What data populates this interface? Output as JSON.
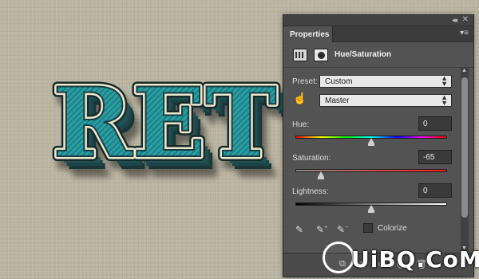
{
  "artwork": {
    "text": "RET"
  },
  "panel": {
    "title": "Properties",
    "adjustment_title": "Hue/Saturation",
    "collapse_glyph": "◂◂",
    "close_glyph": "✕",
    "menu_glyph": "▾≡",
    "preset_label": "Preset:",
    "preset_value": "Custom",
    "channel_value": "Master",
    "hue_label": "Hue:",
    "hue_value": "0",
    "saturation_label": "Saturation:",
    "saturation_value": "-65",
    "lightness_label": "Lightness:",
    "lightness_value": "0",
    "colorize_label": "Colorize",
    "colorize_checked": false,
    "hue_slider_fraction": 0.5,
    "saturation_slider_fraction": 0.175,
    "lightness_slider_fraction": 0.5
  },
  "icons": {
    "adjustment": "hue-saturation-icon",
    "mask": "mask-icon",
    "hand": "targeted-adjustment-hand-icon",
    "eyedropper": "eyedropper-icon",
    "eyedropper_add": "eyedropper-plus-icon",
    "eyedropper_sub": "eyedropper-minus-icon"
  },
  "watermark": {
    "text": "UiBQ.CoM"
  },
  "colors": {
    "panel_bg": "#535353",
    "teal": "#2aa3a8",
    "cream": "#eee7cf",
    "background": "#b9b3a0"
  }
}
